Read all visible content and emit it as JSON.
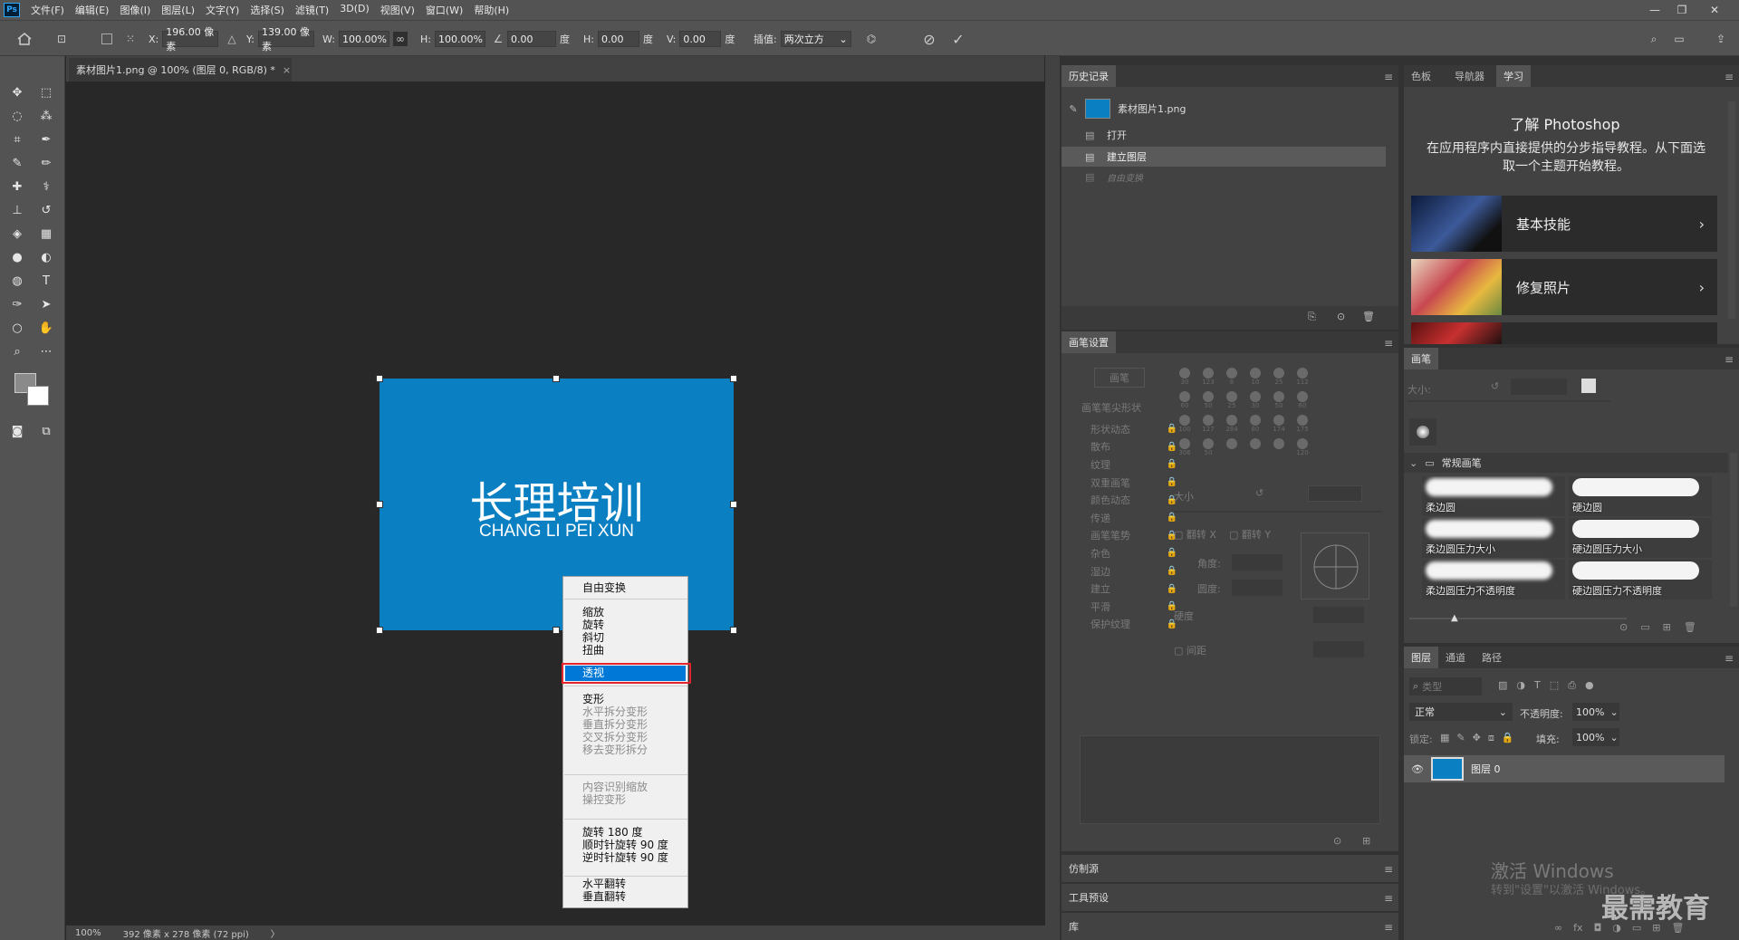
{
  "app": {
    "logo": "Ps"
  },
  "menubar": {
    "items": [
      "文件(F)",
      "编辑(E)",
      "图像(I)",
      "图层(L)",
      "文字(Y)",
      "选择(S)",
      "滤镜(T)",
      "3D(D)",
      "视图(V)",
      "窗口(W)",
      "帮助(H)"
    ],
    "window_controls": [
      "—",
      "❐",
      "✕"
    ]
  },
  "options": {
    "x_label": "X:",
    "x_value": "196.00 像素",
    "y_label": "Y:",
    "y_value": "139.00 像素",
    "w_label": "W:",
    "w_value": "100.00%",
    "h_label": "H:",
    "h_value": "100.00%",
    "angle_value": "0.00",
    "angle_unit": "度",
    "hskew_label": "H:",
    "hskew_value": "0.00",
    "hskew_unit": "度",
    "vskew_label": "V:",
    "vskew_value": "0.00",
    "vskew_unit": "度",
    "interp_label": "插值:",
    "interp_value": "两次立方"
  },
  "document": {
    "tab_title": "素材图片1.png @ 100% (图层 0, RGB/8) *",
    "tab_close": "×",
    "image_title": "长理培训",
    "image_subtitle": "CHANG LI PEI XUN",
    "image_color": "#0a7fc1"
  },
  "statusbar": {
    "zoom": "100%",
    "info": "392 像素 x 278 像素 (72 ppi)",
    "arrow": "〉"
  },
  "context_menu": {
    "items": [
      {
        "label": "自由变换",
        "enabled": true
      },
      {
        "label": "缩放",
        "enabled": true
      },
      {
        "label": "旋转",
        "enabled": true
      },
      {
        "label": "斜切",
        "enabled": true
      },
      {
        "label": "扭曲",
        "enabled": true
      },
      {
        "label": "透视",
        "enabled": true,
        "selected": true
      },
      {
        "label": "变形",
        "enabled": true
      },
      {
        "label": "水平拆分变形",
        "enabled": false
      },
      {
        "label": "垂直拆分变形",
        "enabled": false
      },
      {
        "label": "交叉拆分变形",
        "enabled": false
      },
      {
        "label": "移去变形拆分",
        "enabled": false
      },
      {
        "label": "内容识别缩放",
        "enabled": false
      },
      {
        "label": "操控变形",
        "enabled": false
      },
      {
        "label": "旋转 180 度",
        "enabled": true
      },
      {
        "label": "顺时针旋转 90 度",
        "enabled": true
      },
      {
        "label": "逆时针旋转 90 度",
        "enabled": true
      },
      {
        "label": "水平翻转",
        "enabled": true
      },
      {
        "label": "垂直翻转",
        "enabled": true
      }
    ]
  },
  "history": {
    "tab": "历史记录",
    "snapshot": "素材图片1.png",
    "items": [
      "打开",
      "建立图层",
      "自由变换"
    ]
  },
  "brush_settings": {
    "tab": "画笔设置",
    "brushes_button": "画笔",
    "tip_shape": "画笔笔尖形状",
    "options": [
      "形状动态",
      "散布",
      "纹理",
      "双重画笔",
      "颜色动态",
      "传递",
      "画笔笔势",
      "杂色",
      "湿边",
      "建立",
      "平滑",
      "保护纹理"
    ],
    "tip_sizes": [
      "30",
      "123",
      "8",
      "10",
      "25",
      "112",
      "60",
      "50",
      "25",
      "30",
      "50",
      "60",
      "100",
      "127",
      "284",
      "80",
      "174",
      "175",
      "306",
      "50",
      "",
      "",
      "",
      "120"
    ],
    "size_label": "大小",
    "flip_x": "翻转 X",
    "flip_y": "翻转 Y",
    "angle_label": "角度:",
    "roundness_label": "圆度:",
    "hardness_label": "硬度",
    "spacing_label": "间距"
  },
  "collapsed_panels": [
    "仿制源",
    "工具预设",
    "库"
  ],
  "learn": {
    "tabs": [
      "色板",
      "导航器",
      "学习"
    ],
    "title": "了解 Photoshop",
    "desc": "在应用程序内直接提供的分步指导教程。从下面选取一个主题开始教程。",
    "cards": [
      "基本技能",
      "修复照片"
    ]
  },
  "brushes": {
    "tab": "画笔",
    "size_label": "大小:",
    "group": "常规画笔",
    "items": [
      "柔边圆",
      "硬边圆",
      "柔边圆压力大小",
      "硬边圆压力大小",
      "柔边圆压力不透明度",
      "硬边圆压力不透明度"
    ]
  },
  "layers": {
    "tabs": [
      "图层",
      "通道",
      "路径"
    ],
    "filter_placeholder": "类型",
    "blend_mode": "正常",
    "opacity_label": "不透明度:",
    "opacity_value": "100%",
    "lock_label": "锁定:",
    "fill_label": "填充:",
    "fill_value": "100%",
    "layer_name": "图层 0"
  },
  "watermark": {
    "activate_title": "激活 Windows",
    "activate_sub": "转到\"设置\"以激活 Windows。",
    "brand": "最需教育"
  }
}
